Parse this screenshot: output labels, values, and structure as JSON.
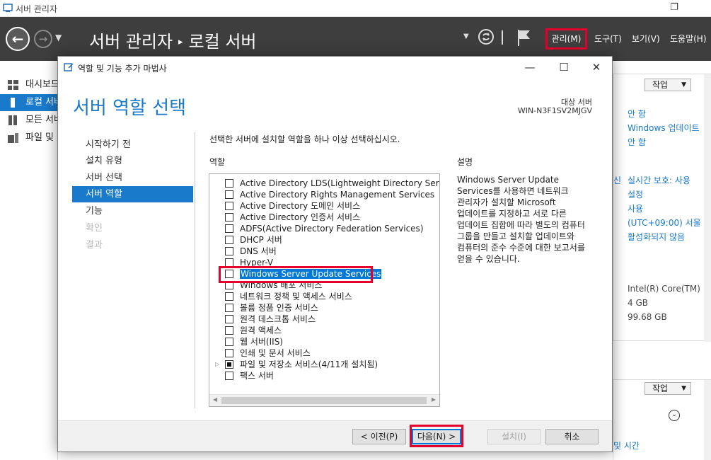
{
  "server_manager": {
    "window_title": "서버 관리자",
    "breadcrumb_app": "서버 관리자",
    "breadcrumb_sep": "▸",
    "breadcrumb_page": "로컬 서버",
    "menu": {
      "manage": "관리(M)",
      "tools": "도구(T)",
      "view": "보기(V)",
      "help": "도움말(H)"
    },
    "sidebar": [
      {
        "label": "대시보드",
        "icon": "dashboard-icon",
        "active": false
      },
      {
        "label": "로컬 서버",
        "icon": "local-server-icon",
        "active": true
      },
      {
        "label": "모든 서버",
        "icon": "all-servers-icon",
        "active": false
      },
      {
        "label": "파일 및 저장소 서비스",
        "icon": "file-storage-icon",
        "active": false
      }
    ],
    "right_panel": {
      "task_button": "작업",
      "properties": [
        "안 함",
        "Windows 업데이트",
        "안 함",
        "실시간 보호: 사용",
        "설정",
        "사용",
        "(UTC+09:00) 서울",
        "활성화되지 않음",
        "Intel(R) Core(TM)",
        "4 GB",
        "99.68 GB"
      ],
      "fragment": "신",
      "task_button_2": "작업",
      "bottom_link": "및 시간"
    }
  },
  "wizard": {
    "title": "역할 및 기능 추가 마법사",
    "heading": "서버 역할 선택",
    "destination_label": "대상 서버",
    "destination_value": "WIN-N3F1SV2MJGV",
    "steps": [
      {
        "label": "시작하기 전",
        "state": "normal"
      },
      {
        "label": "설치 유형",
        "state": "normal"
      },
      {
        "label": "서버 선택",
        "state": "normal"
      },
      {
        "label": "서버 역할",
        "state": "active"
      },
      {
        "label": "기능",
        "state": "normal"
      },
      {
        "label": "확인",
        "state": "disabled"
      },
      {
        "label": "결과",
        "state": "disabled"
      }
    ],
    "instruction": "선택한 서버에 설치할 역할을 하나 이상 선택하십시오.",
    "roles_label": "역할",
    "description_label": "설명",
    "description_text": "Windows Server Update Services를 사용하면 네트워크 관리자가 설치할 Microsoft 업데이트를 지정하고 서로 다른 업데이트 집합에 따라 별도의 컴퓨터 그룹을 만들고 설치할 업데이트와 컴퓨터의 준수 수준에 대한 보고서를 얻을 수 있습니다.",
    "roles": [
      {
        "label": "Active Directory LDS(Lightweight Directory Services)",
        "checked": false
      },
      {
        "label": "Active Directory Rights Management Services",
        "checked": false
      },
      {
        "label": "Active Directory 도메인 서비스",
        "checked": false
      },
      {
        "label": "Active Directory 인증서 서비스",
        "checked": false
      },
      {
        "label": "ADFS(Active Directory Federation Services)",
        "checked": false
      },
      {
        "label": "DHCP 서버",
        "checked": false
      },
      {
        "label": "DNS 서버",
        "checked": false
      },
      {
        "label": "Hyper-V",
        "checked": false
      },
      {
        "label": "Windows Server Update Services",
        "checked": false,
        "selected": true
      },
      {
        "label": "Windows 배포 서비스",
        "checked": false
      },
      {
        "label": "네트워크 정책 및 액세스 서비스",
        "checked": false
      },
      {
        "label": "볼륨 정품 인증 서비스",
        "checked": false
      },
      {
        "label": "원격 데스크톱 서비스",
        "checked": false
      },
      {
        "label": "원격 액세스",
        "checked": false
      },
      {
        "label": "웹 서버(IIS)",
        "checked": false
      },
      {
        "label": "인쇄 및 문서 서비스",
        "checked": false
      },
      {
        "label": "파일 및 저장소 서비스(4/11개 설치됨)",
        "checked": "partial",
        "expandable": true
      },
      {
        "label": "팩스 서버",
        "checked": false
      }
    ],
    "buttons": {
      "previous": "< 이전(P)",
      "next": "다음(N) >",
      "install": "설치(I)",
      "cancel": "취소"
    }
  },
  "colors": {
    "accent": "#1979ca",
    "highlight_box": "#e4002b",
    "header_bg": "#3e3e3e",
    "selection": "#0078d7"
  }
}
